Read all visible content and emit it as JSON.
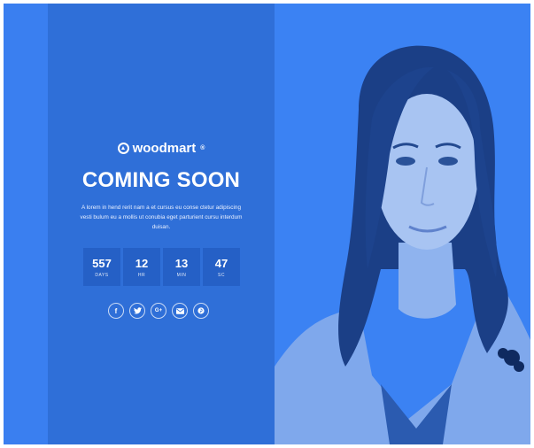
{
  "brand": {
    "name": "woodmart",
    "tm": "®"
  },
  "hero": {
    "title": "COMING SOON",
    "description": "A lorem in hend rerit nam a et cursus eu conse ctetur adipiscing vesti bulum eu a mollis ut conubia eget parturient cursu interdum duisan."
  },
  "countdown": [
    {
      "value": "557",
      "label": "DAYS"
    },
    {
      "value": "12",
      "label": "HR"
    },
    {
      "value": "13",
      "label": "MIN"
    },
    {
      "value": "47",
      "label": "SC"
    }
  ],
  "social": [
    {
      "icon": "facebook-icon",
      "glyph": "f"
    },
    {
      "icon": "twitter-icon",
      "glyph": ""
    },
    {
      "icon": "google-plus-icon",
      "glyph": "G+"
    },
    {
      "icon": "email-icon",
      "glyph": ""
    },
    {
      "icon": "pinterest-icon",
      "glyph": ""
    }
  ],
  "colors": {
    "background": "#3a7ff0",
    "panel": "#2f6fd8",
    "countdown_box": "#2560c6",
    "text": "#ffffff"
  }
}
